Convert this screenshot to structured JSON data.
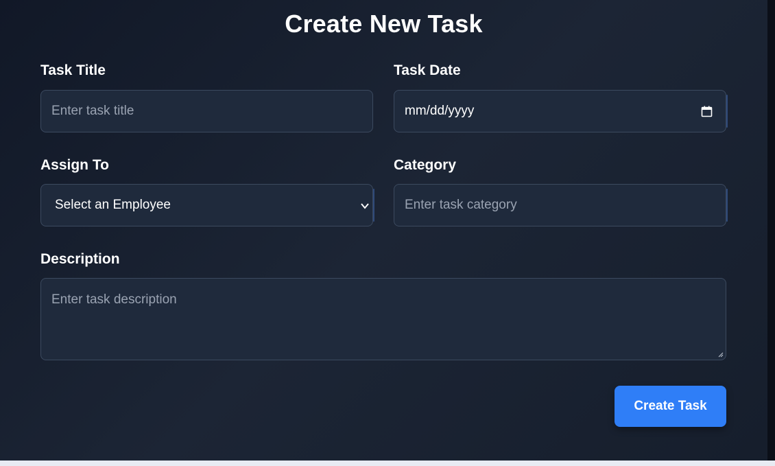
{
  "form": {
    "title": "Create New Task",
    "task_title": {
      "label": "Task Title",
      "placeholder": "Enter task title",
      "value": ""
    },
    "task_date": {
      "label": "Task Date",
      "display_value": "mm/dd/yyyy",
      "icon": "calendar-icon"
    },
    "assign_to": {
      "label": "Assign To",
      "selected": "Select an Employee",
      "icon": "chevron-down-icon"
    },
    "category": {
      "label": "Category",
      "placeholder": "Enter task category",
      "value": ""
    },
    "description": {
      "label": "Description",
      "placeholder": "Enter task description",
      "value": ""
    },
    "submit_label": "Create Task"
  },
  "colors": {
    "background": "#111827",
    "field_background": "#1f2a3c",
    "field_border": "#3c4a5f",
    "accent": "#2f7ef7",
    "text": "#ffffff",
    "placeholder": "#9aa3b2"
  }
}
